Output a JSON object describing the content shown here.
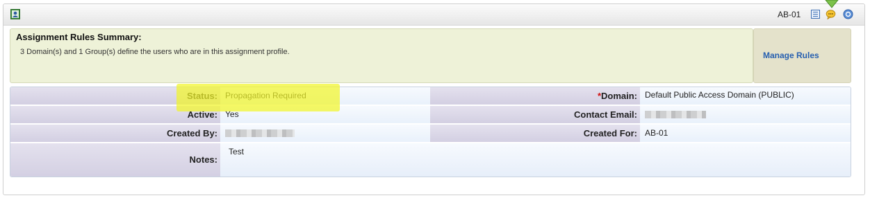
{
  "header": {
    "record_id": "AB-01",
    "icons": [
      "app-profile-icon",
      "list-view-icon",
      "comments-icon",
      "help-icon"
    ]
  },
  "summary": {
    "title": "Assignment Rules Summary:",
    "text": "3 Domain(s) and 1 Group(s) define the users who are in this assignment profile.",
    "manage_link": "Manage Rules"
  },
  "details": {
    "status_label": "Status:",
    "status_value": "Propagation Required",
    "active_label": "Active:",
    "active_value": "Yes",
    "created_by_label": "Created By:",
    "notes_label": "Notes:",
    "notes_value": "Test",
    "domain_required_mark": "*",
    "domain_label": "Domain:",
    "domain_value": "Default Public Access Domain (PUBLIC)",
    "contact_email_label": "Contact Email:",
    "created_for_label": "Created For:",
    "created_for_value": "AB-01"
  },
  "colors": {
    "highlight": "#f1f52a",
    "link": "#2760b0",
    "summary_bg": "#eef2d8",
    "required": "#d01010"
  }
}
